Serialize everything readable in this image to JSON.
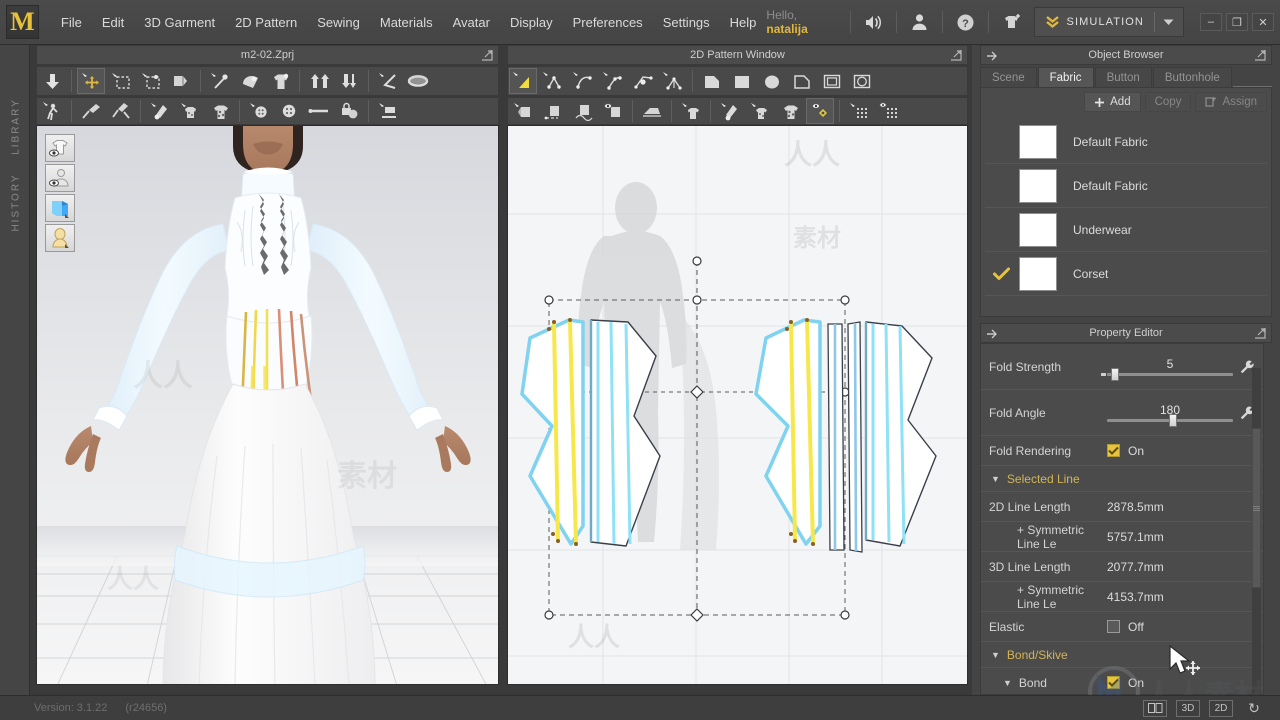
{
  "app": {
    "logo": "M",
    "greeting_prefix": "Hello,",
    "user": "natalija",
    "mode_label": "SIMULATION"
  },
  "menu": {
    "items": [
      {
        "label": "File"
      },
      {
        "label": "Edit"
      },
      {
        "label": "3D Garment"
      },
      {
        "label": "2D Pattern"
      },
      {
        "label": "Sewing"
      },
      {
        "label": "Materials"
      },
      {
        "label": "Avatar"
      },
      {
        "label": "Display"
      },
      {
        "label": "Preferences"
      },
      {
        "label": "Settings"
      },
      {
        "label": "Help"
      }
    ],
    "icons": [
      "speaker-icon",
      "user-icon",
      "help-icon",
      "garment-add-icon"
    ],
    "window_buttons": [
      "minimize",
      "restore",
      "close"
    ]
  },
  "left_rail": {
    "library": "LIBRARY",
    "history": "HISTORY"
  },
  "viewport_3d": {
    "title": "m2-02.Zprj",
    "overlay_icons": [
      "show-garment-icon",
      "show-avatar-icon",
      "show-pattern-icon",
      "show-skin-icon"
    ]
  },
  "viewport_2d": {
    "title": "2D Pattern Window"
  },
  "object_browser": {
    "title": "Object Browser",
    "tabs": [
      {
        "label": "Scene",
        "selected": false
      },
      {
        "label": "Fabric",
        "selected": true
      },
      {
        "label": "Button",
        "selected": false
      },
      {
        "label": "Buttonhole",
        "selected": false
      }
    ],
    "actions": [
      {
        "label": "Add",
        "enabled": true,
        "icon": "plus-icon"
      },
      {
        "label": "Copy",
        "enabled": false,
        "icon": ""
      },
      {
        "label": "Assign",
        "enabled": false,
        "icon": "assign-icon"
      }
    ],
    "fabrics": [
      {
        "name": "Default Fabric",
        "selected": false,
        "swatch": "#ffffff"
      },
      {
        "name": "Default Fabric",
        "selected": false,
        "swatch": "#ffffff"
      },
      {
        "name": "Underwear",
        "selected": false,
        "swatch": "#ffffff"
      },
      {
        "name": "Corset",
        "selected": true,
        "swatch": "#ffffff"
      }
    ]
  },
  "property_editor": {
    "title": "Property Editor",
    "fold_strength": {
      "label": "Fold Strength",
      "value": "5",
      "slider_pct": 5
    },
    "fold_angle": {
      "label": "Fold Angle",
      "value": "180",
      "slider_pct": 51
    },
    "fold_rendering": {
      "label": "Fold Rendering",
      "value": "On",
      "checked": true
    },
    "sections": [
      {
        "label": "Selected Line",
        "expanded": true,
        "rows": [
          {
            "label": "2D Line Length",
            "value": "2878.5mm",
            "indent": false,
            "type": "text"
          },
          {
            "label": "+ Symmetric Line Le",
            "value": "5757.1mm",
            "indent": true,
            "type": "text"
          },
          {
            "label": "3D Line Length",
            "value": "2077.7mm",
            "indent": false,
            "type": "text"
          },
          {
            "label": "+ Symmetric Line Le",
            "value": "4153.7mm",
            "indent": true,
            "type": "text"
          },
          {
            "label": "Elastic",
            "value": "Off",
            "indent": false,
            "type": "check",
            "checked": false
          }
        ]
      },
      {
        "label": "Bond/Skive",
        "expanded": true,
        "rows": [
          {
            "label": "Bond",
            "value": "On",
            "indent": true,
            "type": "check",
            "checked": true,
            "caret": true
          }
        ]
      }
    ]
  },
  "status_bar": {
    "version": "Version: 3.1.22",
    "revision": "(r24656)",
    "view_buttons": [
      {
        "label": "",
        "name": "split-view-button"
      },
      {
        "label": "3D",
        "name": "view-3d-button"
      },
      {
        "label": "2D",
        "name": "view-2d-button"
      },
      {
        "label": "↻",
        "name": "reset-view-button"
      }
    ]
  },
  "colors": {
    "accent_yellow": "#e2b83c",
    "panel_bg": "#4b4b4b",
    "chrome_bg": "#454545",
    "section_label": "#d4b554",
    "pattern_outline_blue": "#7fd3f0",
    "pattern_fill_yellow": "#f7e84a"
  }
}
